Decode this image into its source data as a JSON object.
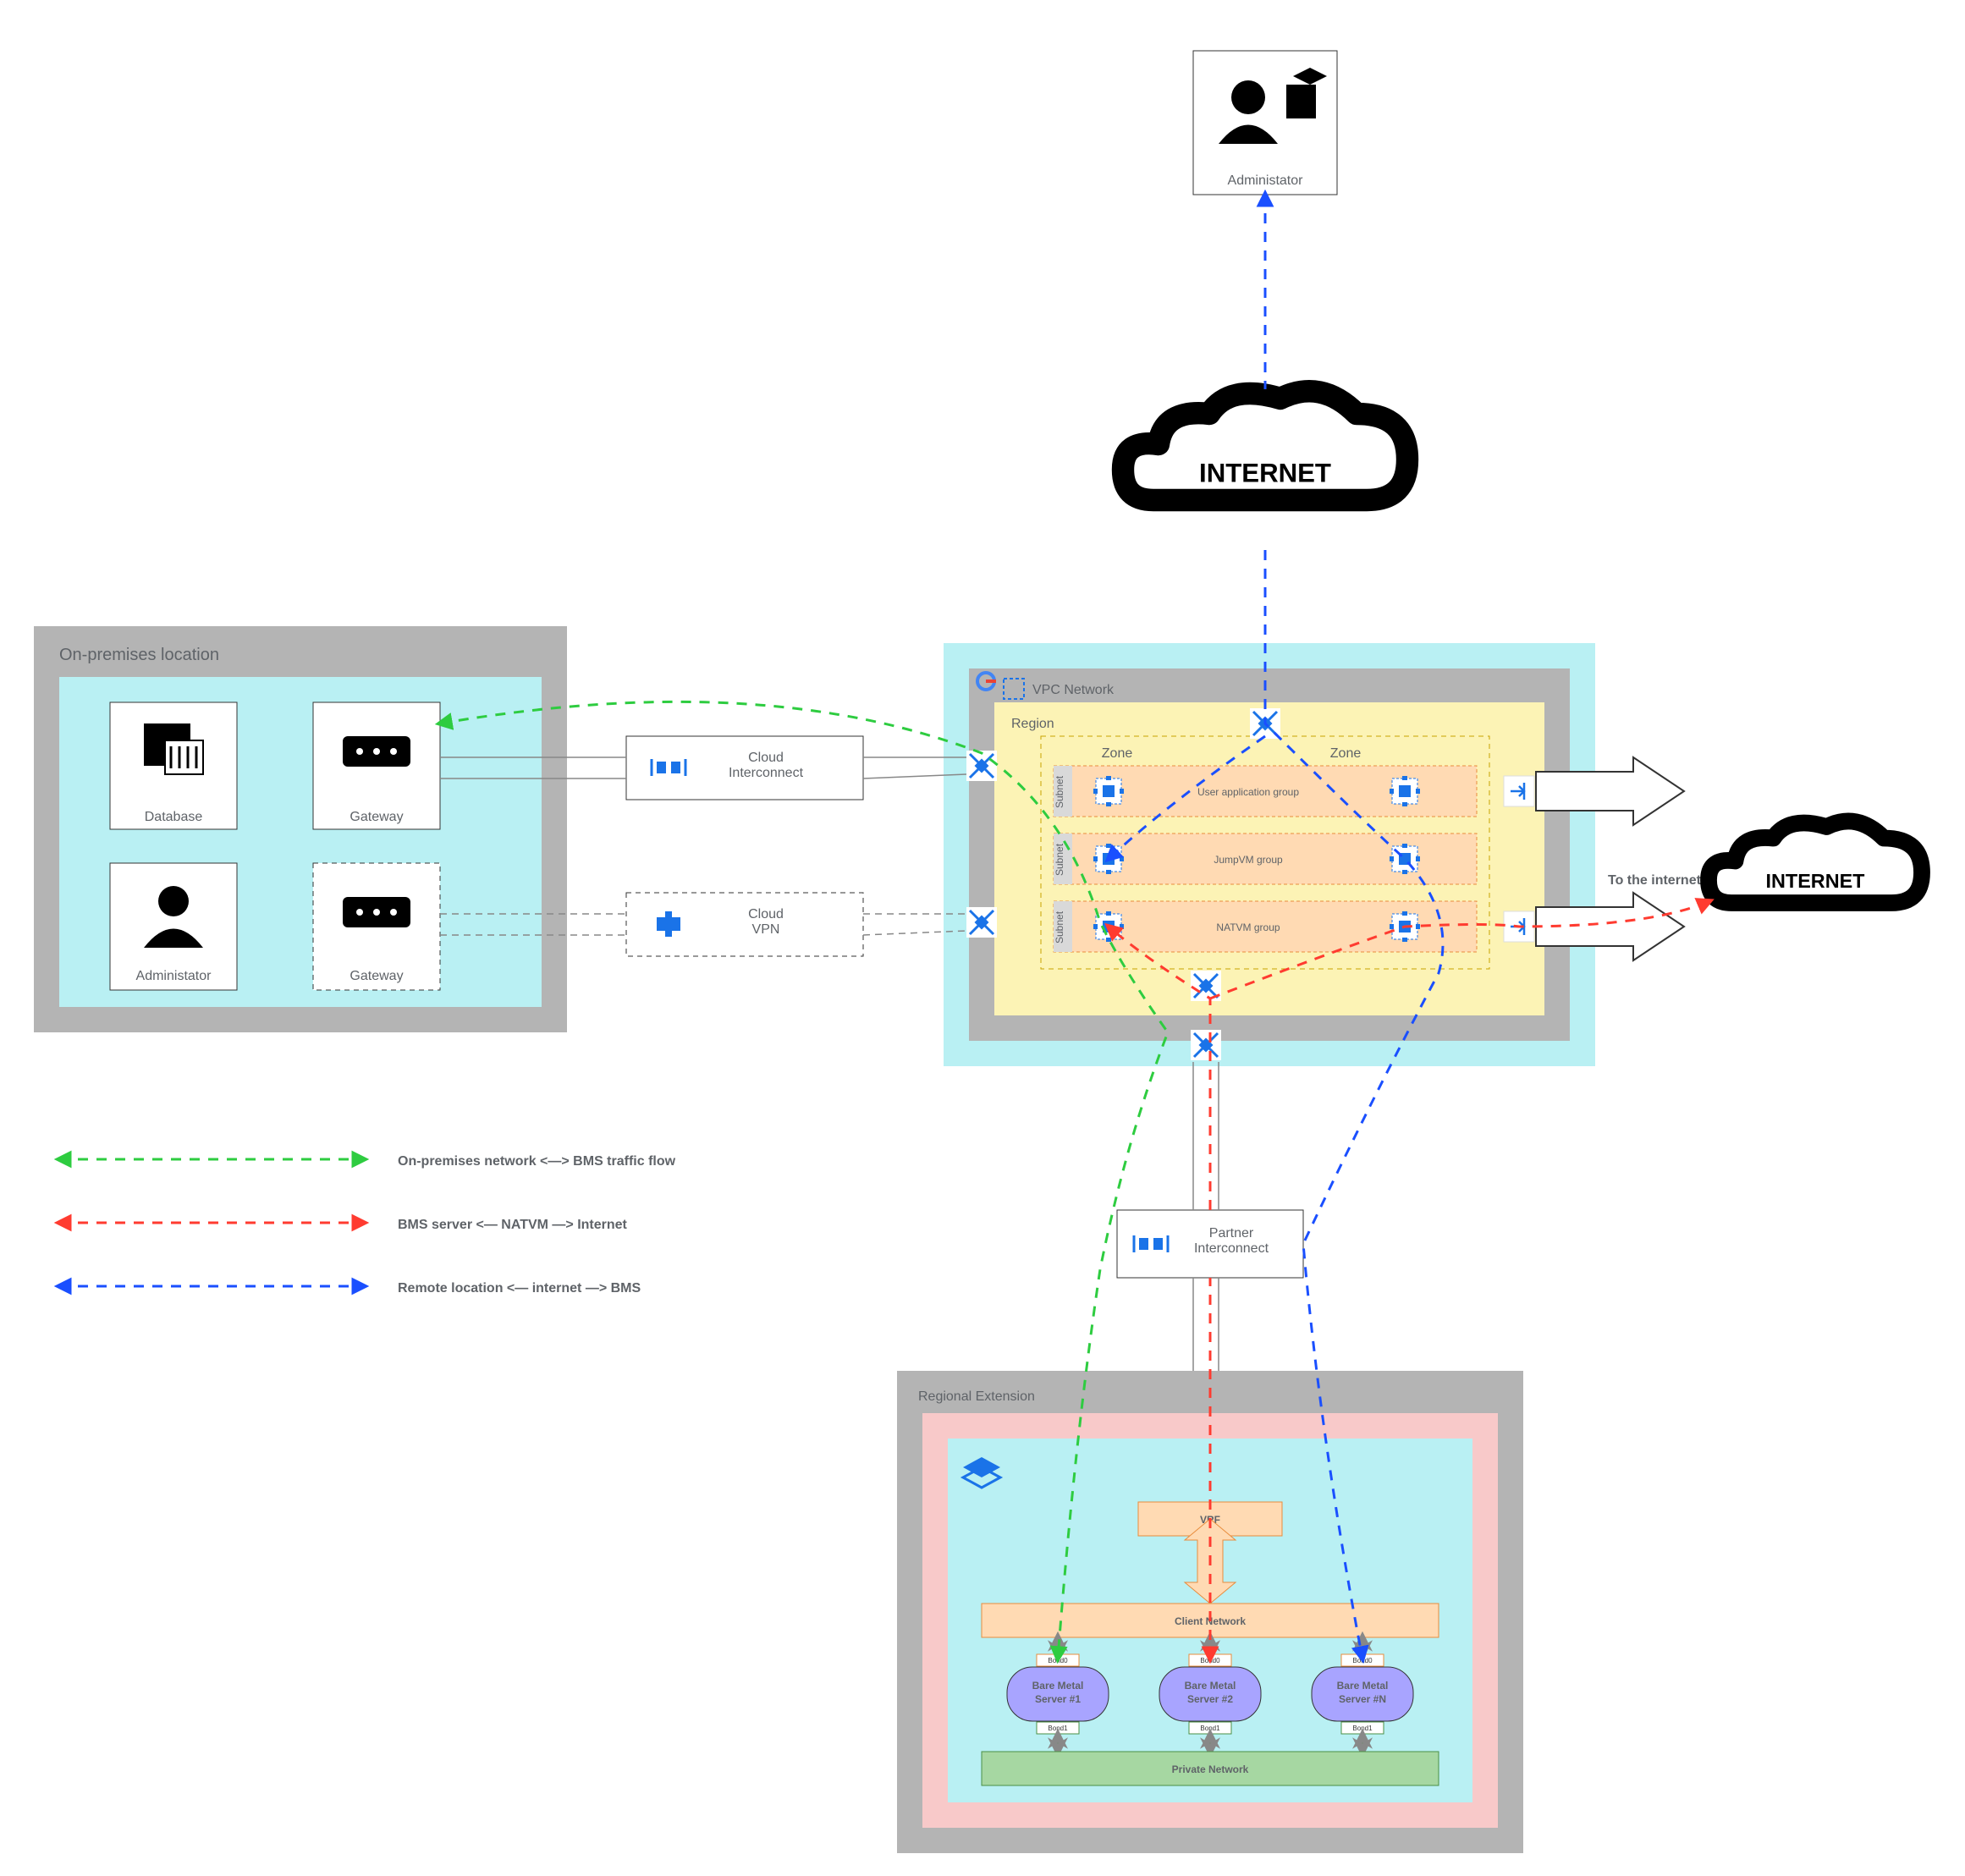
{
  "onprem": {
    "title": "On-premises location",
    "database": "Database",
    "gateway1": "Gateway",
    "gateway2": "Gateway",
    "admin": "Administator"
  },
  "cloud_interconnect": "Cloud\nInterconnect",
  "cloud_vpn": "Cloud\nVPN",
  "partner_interconnect": "Partner\nInterconnect",
  "vpc": {
    "title": "VPC Network",
    "region": "Region",
    "zone1": "Zone",
    "zone2": "Zone",
    "subnet": "Subnet",
    "uag": "User application group",
    "jump": "JumpVM group",
    "natvm": "NATVM group"
  },
  "to_internet": "To the internet",
  "internet": "INTERNET",
  "admin_top": "Administator",
  "regional_ext": {
    "title": "Regional Extension",
    "vrf": "VRF",
    "client_net": "Client Network",
    "priv_net": "Private Network",
    "bms1": "Bare Metal\nServer #1",
    "bms2": "Bare Metal\nServer #2",
    "bmsN": "Bare Metal\nServer #N",
    "bond0": "Bond0",
    "bond1": "Bond1"
  },
  "legend": {
    "green": "On-premises network <—> BMS traffic flow",
    "red": "BMS server   <— NATVM —>   Internet",
    "blue": "Remote location   <— internet —>   BMS"
  },
  "colors": {
    "green": "#2ecc40",
    "red": "#ff3b30",
    "blue": "#1a4fff"
  }
}
